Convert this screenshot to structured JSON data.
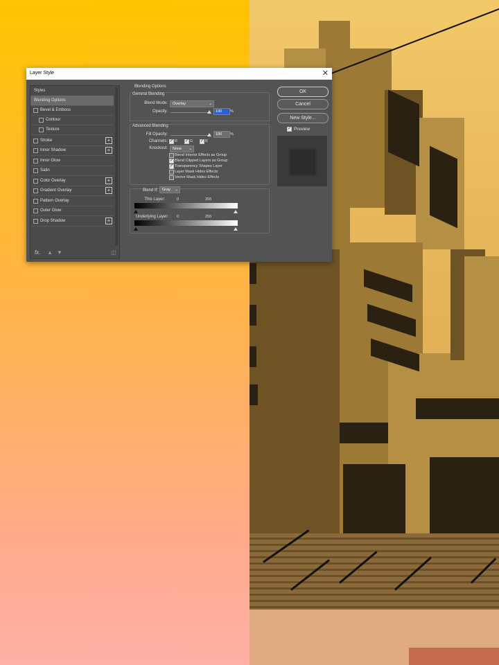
{
  "dialog": {
    "title": "Layer Style",
    "close": "✕",
    "left_panel": {
      "items": [
        {
          "label": "Styles"
        },
        {
          "label": "Blending Options"
        },
        {
          "label": "Bevel & Emboss"
        },
        {
          "label": "Contour"
        },
        {
          "label": "Texture"
        },
        {
          "label": "Stroke"
        },
        {
          "label": "Inner Shadow"
        },
        {
          "label": "Inner Glow"
        },
        {
          "label": "Satin"
        },
        {
          "label": "Color Overlay"
        },
        {
          "label": "Gradient Overlay"
        },
        {
          "label": "Pattern Overlay"
        },
        {
          "label": "Outer Glow"
        },
        {
          "label": "Drop Shadow"
        }
      ],
      "fx_label": "fx.",
      "plus": "+"
    },
    "blending_options": {
      "title": "Blending Options",
      "general": {
        "title": "General Blending",
        "blend_mode_label": "Blend Mode:",
        "blend_mode_value": "Overlay",
        "opacity_label": "Opacity:",
        "opacity_value": "100",
        "percent": "%"
      },
      "advanced": {
        "title": "Advanced Blending",
        "fill_opacity_label": "Fill Opacity:",
        "fill_opacity_value": "100",
        "percent": "%",
        "channels_label": "Channels:",
        "channel_r": "R",
        "channel_g": "G",
        "channel_b": "B",
        "knockout_label": "Knockout:",
        "knockout_value": "None",
        "options": [
          {
            "label": "Blend Interior Effects as Group",
            "checked": false
          },
          {
            "label": "Blend Clipped Layers as Group",
            "checked": true
          },
          {
            "label": "Transparency Shapes Layer",
            "checked": true
          },
          {
            "label": "Layer Mask Hides Effects",
            "checked": false
          },
          {
            "label": "Vector Mask Hides Effects",
            "checked": false
          }
        ]
      },
      "blend_if": {
        "label": "Blend If:",
        "value": "Gray",
        "this_layer_label": "This Layer:",
        "this_layer_min": "0",
        "this_layer_max": "255",
        "underlying_label": "Underlying Layer:",
        "underlying_min": "0",
        "underlying_max": "255"
      }
    },
    "buttons": {
      "ok": "OK",
      "cancel": "Cancel",
      "new_style": "New Style...",
      "preview_label": "Preview"
    }
  }
}
